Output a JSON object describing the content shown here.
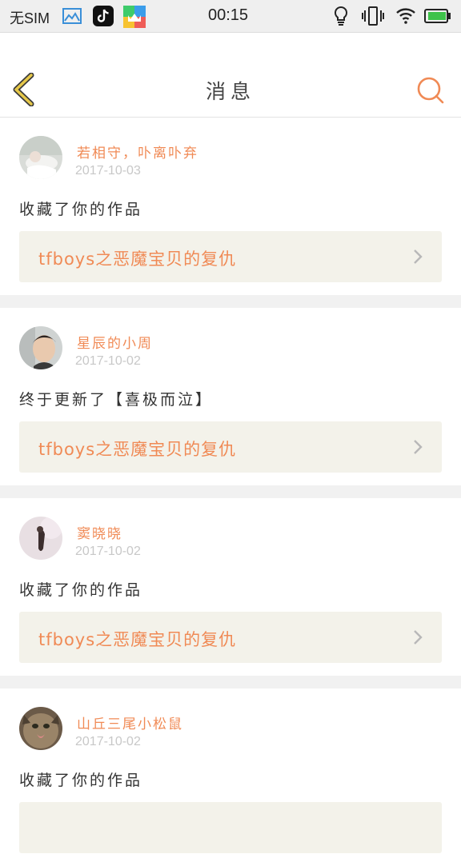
{
  "status_bar": {
    "carrier": "无SIM",
    "time": "00:15"
  },
  "header": {
    "title": "消息",
    "back_icon": "chevron-left-icon",
    "search_icon": "search-icon"
  },
  "colors": {
    "accent": "#f08a55",
    "card_bg": "#f3f2ea",
    "date": "#c8c8c8",
    "back_icon_fill": "#e6c84a"
  },
  "messages": [
    {
      "user": "若相守，卟离卟弃",
      "date": "2017-10-03",
      "text": "收藏了你的作品",
      "work_title": "tfboys之恶魔宝贝的复仇",
      "avatar": "avatar-1"
    },
    {
      "user": "星辰的小周",
      "date": "2017-10-02",
      "text": "终于更新了【喜极而泣】",
      "work_title": "tfboys之恶魔宝贝的复仇",
      "avatar": "avatar-2"
    },
    {
      "user": "窦晓晓",
      "date": "2017-10-02",
      "text": "收藏了你的作品",
      "work_title": "tfboys之恶魔宝贝的复仇",
      "avatar": "avatar-3"
    },
    {
      "user": "山丘三尾小松鼠",
      "date": "2017-10-02",
      "text": "收藏了你的作品",
      "work_title": "",
      "avatar": "avatar-4"
    }
  ]
}
